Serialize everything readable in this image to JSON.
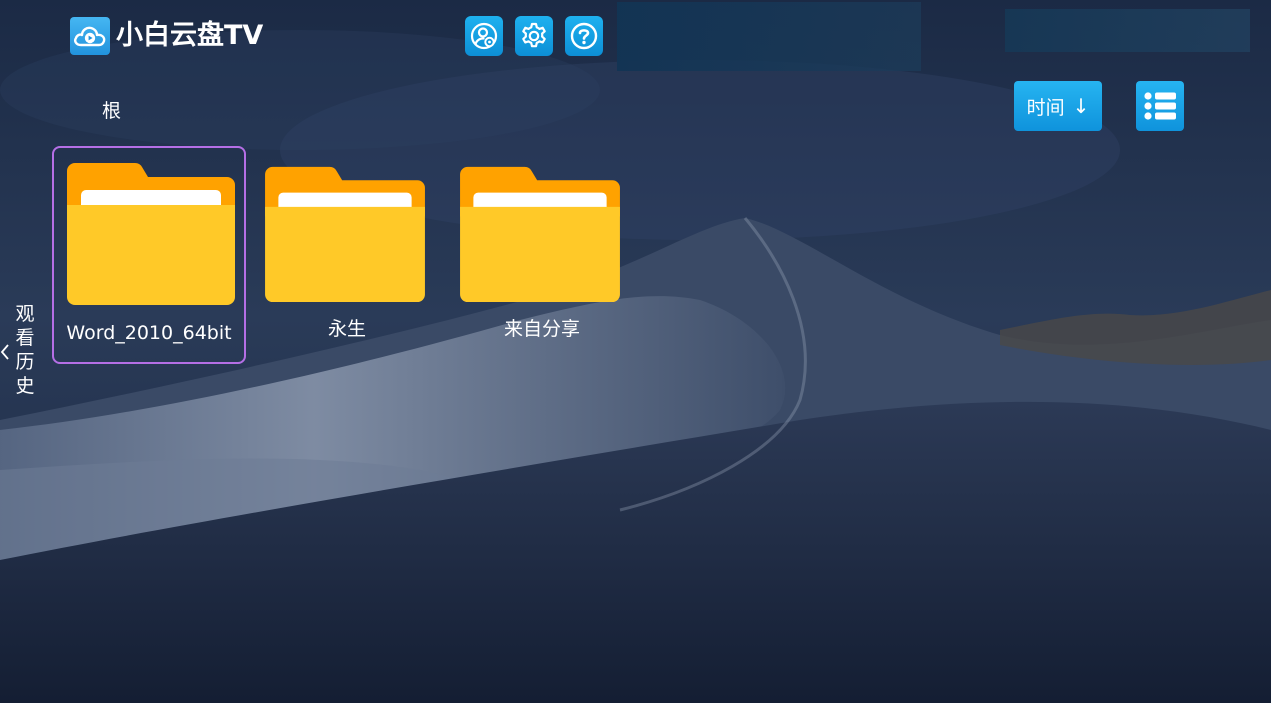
{
  "app": {
    "title": "小白云盘TV",
    "logo_icon": "cloud-play-icon"
  },
  "header": {
    "buttons": [
      {
        "icon": "account-settings-icon"
      },
      {
        "icon": "gear-icon"
      },
      {
        "icon": "help-icon"
      }
    ]
  },
  "breadcrumb": {
    "current": "根"
  },
  "toolbar": {
    "sort_label": "时间",
    "sort_arrow": "↓",
    "view_icon": "list-view-icon"
  },
  "side_tab": {
    "label": "观看历史",
    "icon": "chevron-left-icon"
  },
  "folders": [
    {
      "name": "Word_2010_64bit",
      "focused": true
    },
    {
      "name": "永生",
      "focused": false
    },
    {
      "name": "来自分享",
      "focused": false
    }
  ],
  "colors": {
    "accent": "#13a2e4",
    "focus_border": "#b56fe6",
    "folder_front": "#ffc928",
    "folder_back": "#ffa200"
  }
}
